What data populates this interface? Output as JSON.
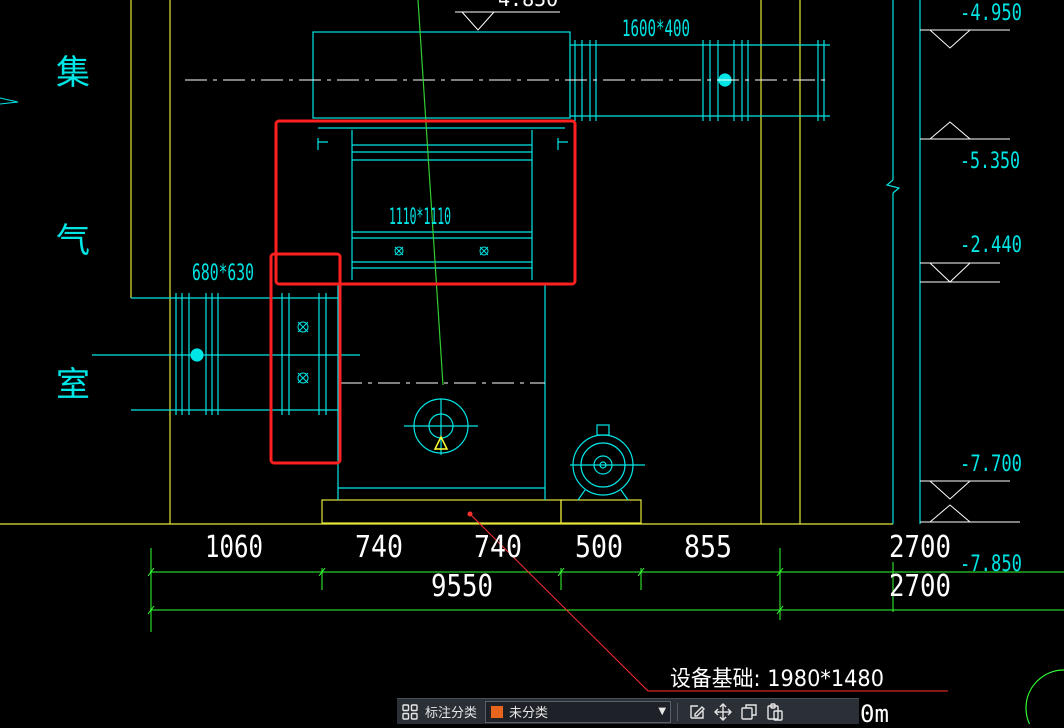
{
  "labels": {
    "chars": [
      "集",
      "气",
      "室"
    ],
    "duct_top": "1600*400",
    "duct_mid": "1110*1110",
    "duct_left": "680*630",
    "elev_top": "4.850",
    "elev_1": "-4.950",
    "elev_2": "-5.350",
    "elev_3": "-2.440",
    "elev_4": "-7.700",
    "elev_5": "-7.850",
    "dims_row1": [
      "1060",
      "740",
      "740",
      "500",
      "855",
      "2700"
    ],
    "dims_row2": [
      "9550",
      "2700"
    ],
    "base_note": "设备基础: 1980*1480",
    "partial_unit": "0m"
  },
  "toolbar": {
    "category_label": "标注分类",
    "category_value": "未分类",
    "swatch_color": "#e8651e"
  },
  "colors": {
    "cyan": "#00e5e5",
    "yellow": "#ffff33",
    "green": "#33ff33",
    "red": "#ff2020",
    "white": "#ffffff"
  }
}
